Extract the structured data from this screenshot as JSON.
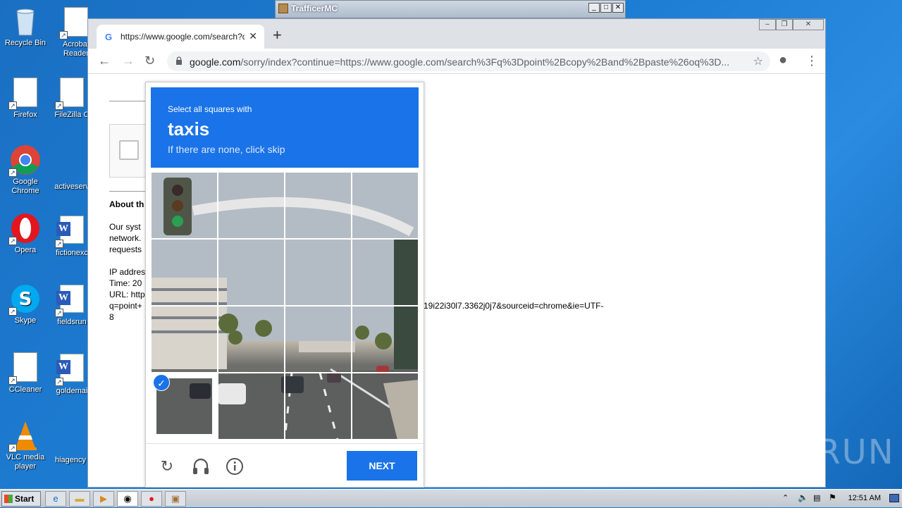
{
  "desktop": {
    "icons": [
      {
        "label": "Recycle Bin",
        "icon": "recycle-bin-icon"
      },
      {
        "label": "Acrobat Reader",
        "icon": "acrobat-icon"
      },
      {
        "label": "Firefox",
        "icon": "document-icon"
      },
      {
        "label": "FileZilla C",
        "icon": "document-icon"
      },
      {
        "label": "Google Chrome",
        "icon": "chrome-icon"
      },
      {
        "label": "activeserv",
        "icon": "document-icon"
      },
      {
        "label": "Opera",
        "icon": "opera-icon"
      },
      {
        "label": "fictionexc",
        "icon": "word-icon"
      },
      {
        "label": "Skype",
        "icon": "skype-icon"
      },
      {
        "label": "fieldsrun",
        "icon": "word-icon"
      },
      {
        "label": "CCleaner",
        "icon": "document-icon"
      },
      {
        "label": "goldemai",
        "icon": "word-icon"
      },
      {
        "label": "VLC media player",
        "icon": "vlc-icon"
      },
      {
        "label": "hiagency",
        "icon": "word-icon"
      }
    ]
  },
  "bg_window": {
    "title": "TrafficerMC"
  },
  "browser": {
    "tab_title": "https://www.google.com/search?q=",
    "url_host": "google.com",
    "url_rest": "/sorry/index?continue=https://www.google.com/search%3Fq%3Dpoint%2Bcopy%2Band%2Bpaste%26oq%3D..."
  },
  "page": {
    "about_heading": "About th",
    "para1": [
      "Our syst",
      "network.",
      "requests"
    ],
    "ip_line": "IP addres",
    "time_line": "Time: 20",
    "url_line": "URL: http",
    "q_line": "q=point+",
    "tail_line": "19i22i30l7.3362j0j7&sourceid=chrome&ie=UTF-",
    "tail_line2": "8"
  },
  "captcha": {
    "instruction": "Select all squares with",
    "target": "taxis",
    "hint": "If there are none, click skip",
    "next_label": "NEXT",
    "selected_tiles": [
      12
    ]
  },
  "watermark": "ANY RUN",
  "taskbar": {
    "start_label": "Start",
    "clock": "12:51 AM"
  },
  "colors": {
    "accent": "#1a73e8",
    "desktop": "#1d7dd3"
  }
}
